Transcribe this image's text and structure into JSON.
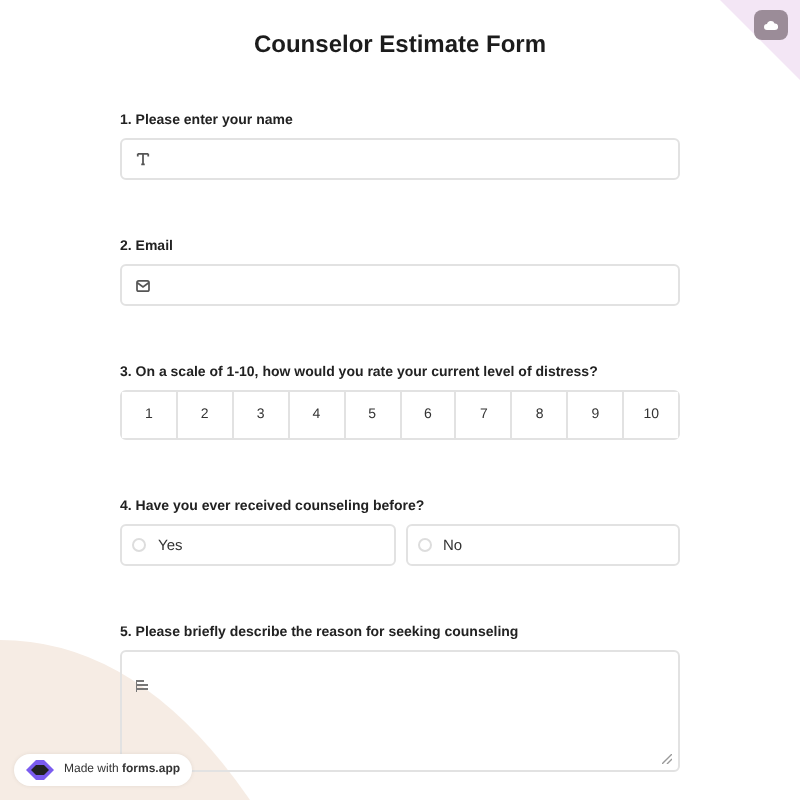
{
  "title": "Counselor Estimate Form",
  "questions": [
    {
      "kind": "text",
      "label": "1.  Please enter your name"
    },
    {
      "kind": "email",
      "label": "2. Email"
    },
    {
      "kind": "scale",
      "label": "3. On a scale of 1-10, how would you rate your current level of distress?",
      "options": [
        {
          "label": "1",
          "selected": false
        },
        {
          "label": "2",
          "selected": false
        },
        {
          "label": "3",
          "selected": false
        },
        {
          "label": "4",
          "selected": false
        },
        {
          "label": "5",
          "selected": false
        },
        {
          "label": "6",
          "selected": false
        },
        {
          "label": "7",
          "selected": false
        },
        {
          "label": "8",
          "selected": false
        },
        {
          "label": "9",
          "selected": false
        },
        {
          "label": "10",
          "selected": false
        }
      ]
    },
    {
      "kind": "choice",
      "label": "4. Have you ever received counseling before?",
      "options": [
        {
          "label": "Yes",
          "selected": false
        },
        {
          "label": "No",
          "selected": false
        }
      ]
    },
    {
      "kind": "textarea",
      "label": "5. Please briefly describe the reason for seeking counseling"
    }
  ],
  "badge": "Made with **forms.app**"
}
